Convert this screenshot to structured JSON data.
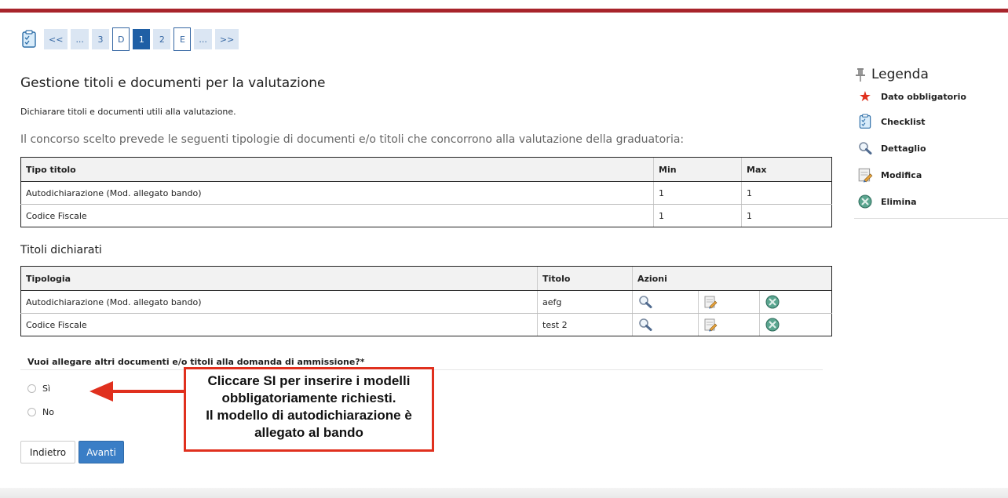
{
  "nav": {
    "steps": [
      "<<",
      "...",
      "3",
      "D",
      "1",
      "2",
      "E",
      "...",
      ">>"
    ],
    "current_step": "1"
  },
  "page": {
    "title": "Gestione titoli e documenti per la valutazione",
    "intro": "Dichiarare titoli e documenti utili alla valutazione.",
    "lead": "Il concorso scelto prevede le seguenti tipologie di documenti e/o titoli che concorrono alla valutazione della graduatoria:"
  },
  "types_table": {
    "headers": [
      "Tipo titolo",
      "Min",
      "Max"
    ],
    "rows": [
      [
        "Autodichiarazione (Mod. allegato bando)",
        "1",
        "1"
      ],
      [
        "Codice Fiscale",
        "1",
        "1"
      ]
    ]
  },
  "declared": {
    "title": "Titoli dichiarati",
    "headers": [
      "Tipologia",
      "Titolo",
      "Azioni"
    ],
    "rows": [
      [
        "Autodichiarazione (Mod. allegato bando)",
        "aefg"
      ],
      [
        "Codice Fiscale",
        "test 2"
      ]
    ]
  },
  "question": {
    "text": "Vuoi allegare altri documenti e/o titoli alla domanda di ammissione?*",
    "options": [
      "Sì",
      "No"
    ]
  },
  "buttons": {
    "back": "Indietro",
    "next": "Avanti"
  },
  "annotation": {
    "lines": [
      "Cliccare SI per inserire i modelli",
      "obbligatoriamente richiesti.",
      "Il modello di autodichiarazione è",
      "allegato al bando"
    ],
    "color": "#e0301e"
  },
  "legend": {
    "title": "Legenda",
    "items": [
      {
        "icon": "asterisk-icon",
        "label": "Dato obbligatorio"
      },
      {
        "icon": "checklist-icon",
        "label": "Checklist"
      },
      {
        "icon": "magnifier-icon",
        "label": "Dettaglio"
      },
      {
        "icon": "edit-icon",
        "label": "Modifica"
      },
      {
        "icon": "delete-icon",
        "label": "Elimina"
      }
    ]
  },
  "colors": {
    "brand": "#a8242b",
    "primary": "#3a7ec6",
    "step_bg": "#dbe6f3"
  }
}
